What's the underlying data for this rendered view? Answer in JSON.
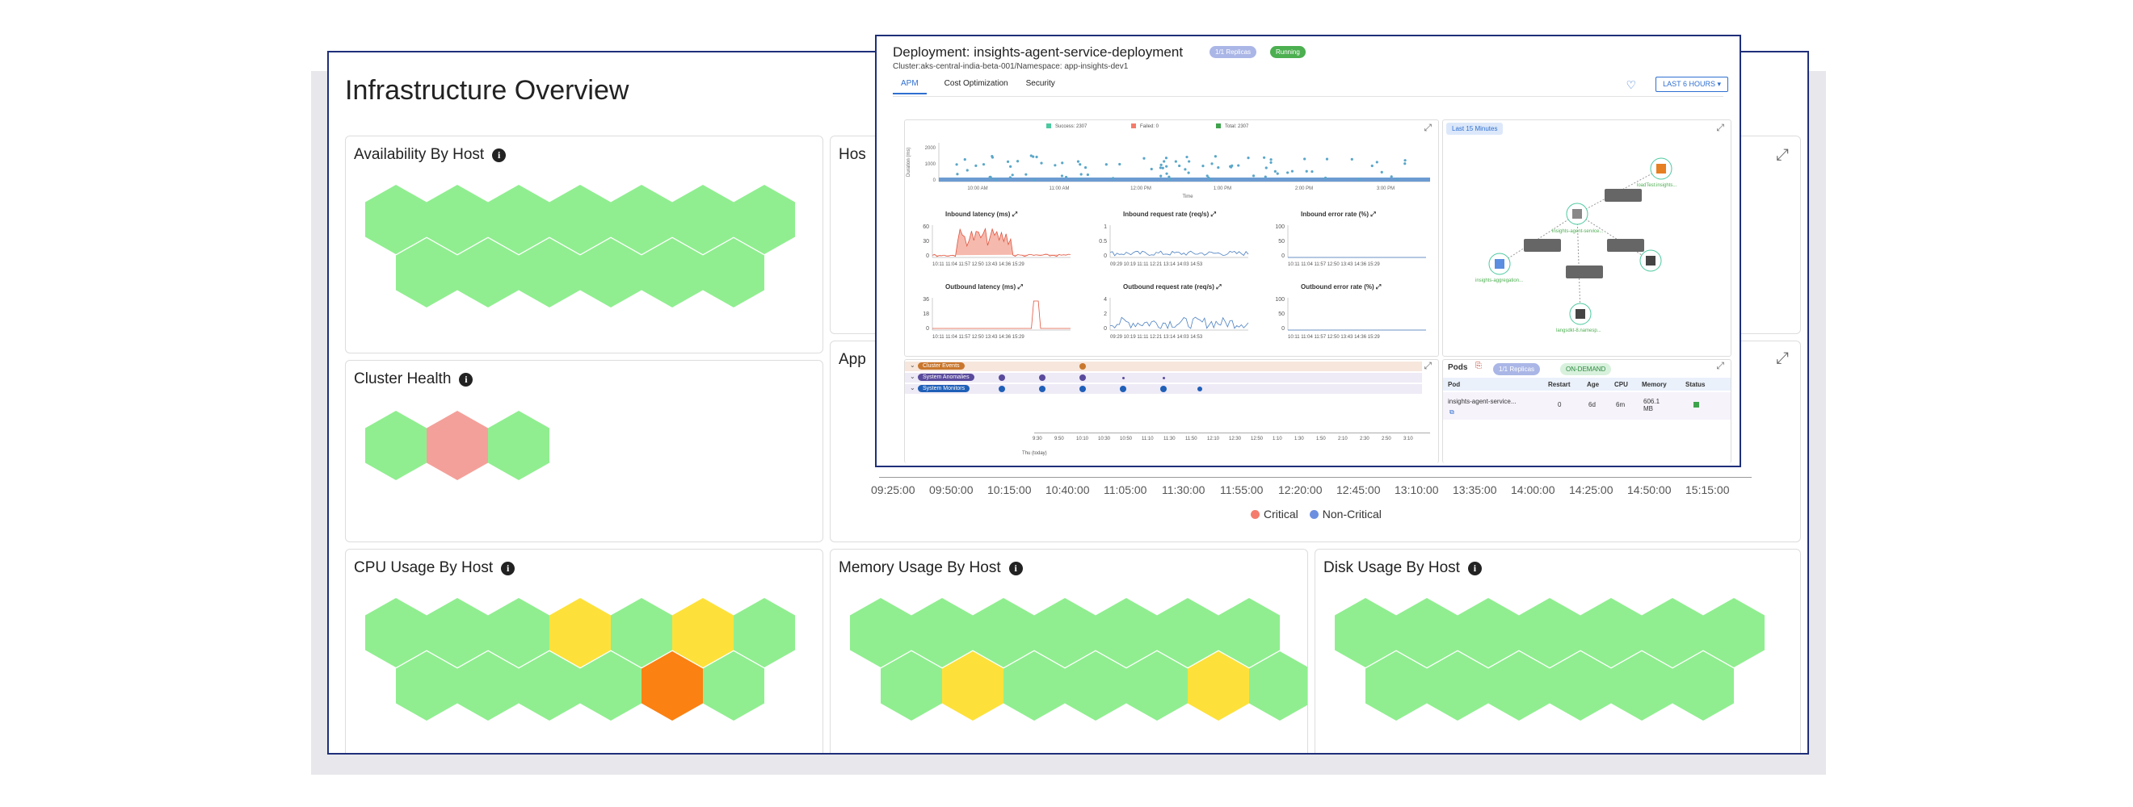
{
  "overview": {
    "title": "Infrastructure Overview",
    "cards": {
      "availability": {
        "title": "Availability By Host",
        "info": "i"
      },
      "cluster": {
        "title": "Cluster Health",
        "info": "i"
      },
      "host_partial": {
        "title": "Hos"
      },
      "app_partial": {
        "title": "App"
      },
      "cpu": {
        "title": "CPU Usage By Host",
        "info": "i"
      },
      "memory": {
        "title": "Memory Usage By Host",
        "info": "i"
      },
      "disk": {
        "title": "Disk Usage By Host",
        "info": "i"
      }
    },
    "timeline_ticks": [
      "09:25:00",
      "09:50:00",
      "10:15:00",
      "10:40:00",
      "11:05:00",
      "11:30:00",
      "11:55:00",
      "12:20:00",
      "12:45:00",
      "13:10:00",
      "13:35:00",
      "14:00:00",
      "14:25:00",
      "14:50:00",
      "15:15:00"
    ],
    "legend": [
      {
        "label": "Critical",
        "color": "#f47c6c"
      },
      {
        "label": "Non-Critical",
        "color": "#6c8fe0"
      }
    ],
    "colors": {
      "green": "#90ee90",
      "red": "#f4a09a",
      "yellow": "#fde13a",
      "orange": "#fb8112"
    }
  },
  "deployment": {
    "title": "Deployment: insights-agent-service-deployment",
    "subtitle": "Cluster:aks-central-india-beta-001/Namespace: app-insights-dev1",
    "replicas_badge": "1/1 Replicas",
    "status_badge": "Running",
    "tabs": [
      "APM",
      "Cost Optimization",
      "Security"
    ],
    "range_button": "LAST 6 HOURS",
    "legend": [
      "Success: 2307",
      "Failed: 0",
      "Total: 2307"
    ],
    "scatter_y_label": "Duration (ms)",
    "scatter_y_ticks": [
      "2000",
      "1000",
      "0"
    ],
    "scatter_x_ticks": [
      "10:00 AM",
      "11:00 AM",
      "12:00 PM",
      "1:00 PM",
      "2:00 PM",
      "3:00 PM"
    ],
    "scatter_x_title": "Time",
    "mini_charts": [
      {
        "title": "Inbound latency (ms)",
        "yticks": [
          "60",
          "30",
          "0"
        ],
        "xticks": "10:11 11:04 11:57 12:50 13:43 14:36 15:29"
      },
      {
        "title": "Inbound request rate (req/s)",
        "yticks": [
          "1",
          "0.5",
          "0"
        ],
        "xticks": "09:29 10:19 11:11 12:21 13:14 14:03 14:53"
      },
      {
        "title": "Inbound error rate (%)",
        "yticks": [
          "100",
          "50",
          "0"
        ],
        "xticks": "10:11 11:04 11:57 12:50 13:43 14:36 15:29"
      },
      {
        "title": "Outbound latency (ms)",
        "yticks": [
          "36",
          "18",
          "0"
        ],
        "xticks": "10:11 11:04 11:57 12:50 13:43 14:36 15:29"
      },
      {
        "title": "Outbound request rate (req/s)",
        "yticks": [
          "4",
          "2",
          "0"
        ],
        "xticks": "09:29 10:19 11:11 12:21 13:14 14:03 14:53"
      },
      {
        "title": "Outbound error rate (%)",
        "yticks": [
          "100",
          "50",
          "0"
        ],
        "xticks": "10:11 11:04 11:57 12:50 13:43 14:36 15:29"
      }
    ],
    "map_badge": "Last 15 Minutes",
    "events": [
      {
        "label": "Cluster Events",
        "color": "#c9772e"
      },
      {
        "label": "System Anomalies",
        "color": "#5a4a9c"
      },
      {
        "label": "System Monitors",
        "color": "#1f5fb8"
      }
    ],
    "event_ticks": [
      "9:30",
      "9:50",
      "10:10",
      "10:30",
      "10:50",
      "11:10",
      "11:30",
      "11:50",
      "12:10",
      "12:30",
      "12:50",
      "1:10",
      "1:30",
      "1:50",
      "2:10",
      "2:30",
      "2:50",
      "3:10"
    ],
    "event_axis_note": "Thu (today)",
    "pods": {
      "title": "Pods",
      "replicas": "1/1 Replicas",
      "on_demand": "ON-DEMAND",
      "headers": [
        "Pod",
        "Restart",
        "Age",
        "CPU",
        "Memory",
        "Status"
      ],
      "row": {
        "pod": "insights-agent-service...",
        "restart": "0",
        "age": "6d",
        "cpu": "6m",
        "memory": "606.1 MB"
      }
    },
    "map_nodes": [
      "insights-agent-service...",
      "insights-aggregation...",
      "loadTest.insights...",
      "langsdkt-8.namesp..."
    ]
  }
}
